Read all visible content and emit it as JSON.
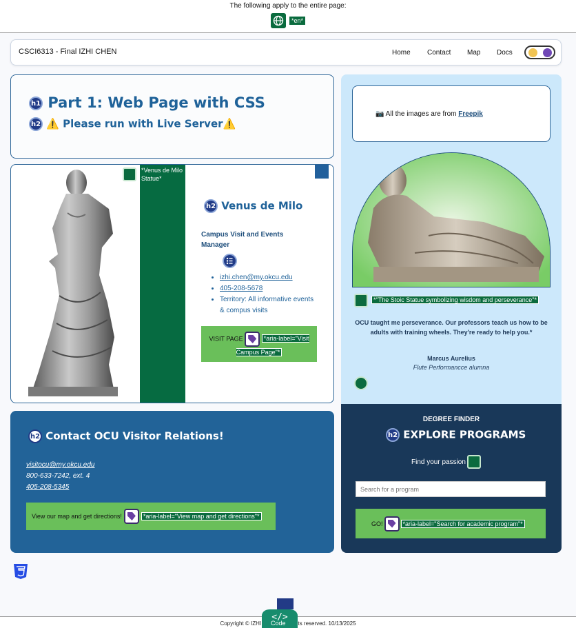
{
  "a11y": {
    "title": "The following apply to the entire page:",
    "lang_tag": "*en*"
  },
  "nav": {
    "brand": "CSCI6313 - Final IZHI CHEN",
    "links": [
      "Home",
      "Contact",
      "Map",
      "Docs"
    ]
  },
  "part1": {
    "h1_badge": "h1",
    "title": "Part 1: Web Page with CSS",
    "h2_badge": "h2",
    "subtitle": "⚠️ Please run with Live Server⚠️"
  },
  "profile": {
    "image_label": "*Venus de Milo Statue*",
    "h2_badge": "h2",
    "name": "Venus de Milo",
    "role": "Campus Visit and Events Manager",
    "email": "izhi.chen@my.okcu.edu",
    "phone": "405-208-5678",
    "territory": "Territory: All informative events & compus visits",
    "visit_label": "VISIT PAGE",
    "visit_aria": "*aria-label=\"Visit Campus Page\"*"
  },
  "contact": {
    "h2_badge": "h2",
    "title": "Contact OCU Visitor Relations!",
    "email": "visitocu@my.okcu.edu",
    "phone1": "800-633-7242, ext. 4",
    "phone2": "405-208-5345",
    "map_label": "View our map and get directions!",
    "map_aria": "*aria-label=\"View map and get directions\"*"
  },
  "credit": {
    "prefix": "📷 All the images are from ",
    "link": "Freepik"
  },
  "testimonial": {
    "caption": "*\"The Stoic Statue symbolizing wisdom and perseverance\"*",
    "quote": "OCU taught me perseverance. Our professors teach us how to be adults with training wheels. They're ready to help you.*",
    "name": "Marcus Aurelius",
    "role": "Flute Performancce alumna"
  },
  "degree": {
    "kicker": "DEGREE FINDER",
    "h2_badge": "h2",
    "title": "EXPLORE PROGRAMS",
    "subtitle": "Find your passion",
    "search_placeholder": "Search for a program",
    "go_label": "GO!",
    "go_aria": "*aria-label=\"Search for academic program\"*"
  },
  "footer": {
    "text": "Copyright © IZHI CHEN. All rights reserved. 10/13/2025",
    "code_label": "Code"
  },
  "colors": {
    "brand_blue": "#226398",
    "navy": "#193859",
    "green": "#6abf5a",
    "light_blue": "#cce8fb"
  }
}
